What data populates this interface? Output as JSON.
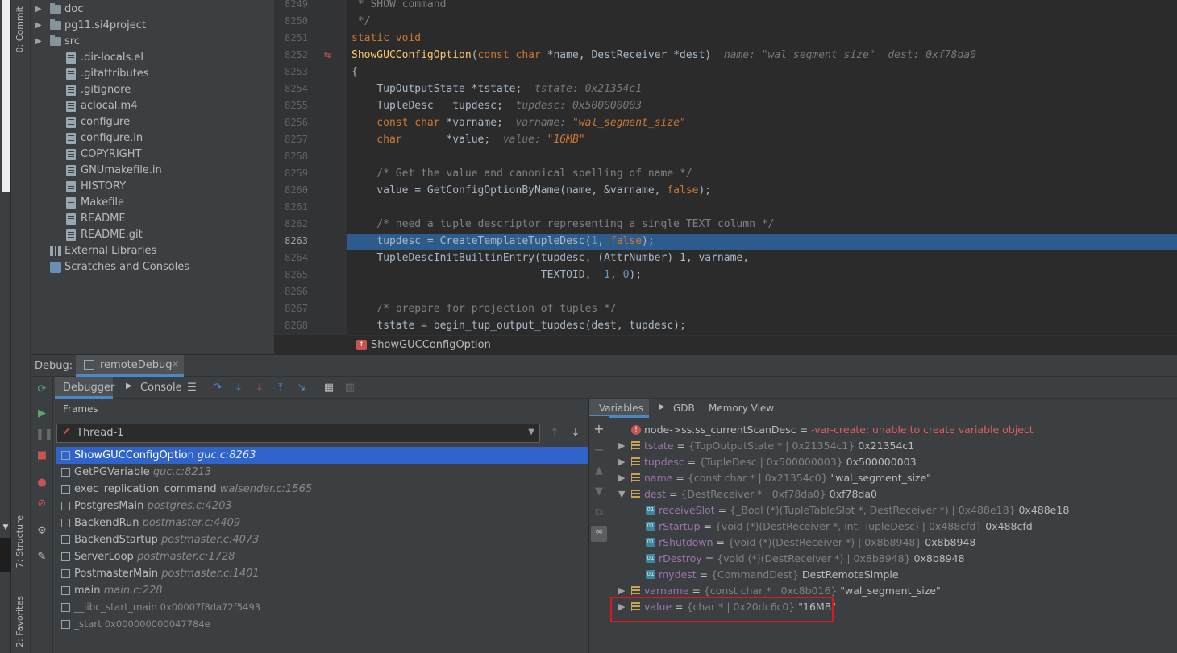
{
  "left_strip": {
    "commit": "0: Commit",
    "structure": "7: Structure",
    "favorites": "2: Favorites"
  },
  "project": {
    "items": [
      {
        "label": "doc",
        "kind": "folder",
        "expandable": true
      },
      {
        "label": "pg11.si4project",
        "kind": "folder",
        "expandable": true
      },
      {
        "label": "src",
        "kind": "folder",
        "expandable": true
      },
      {
        "label": ".dir-locals.el",
        "kind": "file"
      },
      {
        "label": ".gitattributes",
        "kind": "file"
      },
      {
        "label": ".gitignore",
        "kind": "file"
      },
      {
        "label": "aclocal.m4",
        "kind": "file"
      },
      {
        "label": "configure",
        "kind": "file"
      },
      {
        "label": "configure.in",
        "kind": "file"
      },
      {
        "label": "COPYRIGHT",
        "kind": "file"
      },
      {
        "label": "GNUmakefile.in",
        "kind": "file"
      },
      {
        "label": "HISTORY",
        "kind": "file"
      },
      {
        "label": "Makefile",
        "kind": "file"
      },
      {
        "label": "README",
        "kind": "file"
      },
      {
        "label": "README.git",
        "kind": "file"
      },
      {
        "label": "External Libraries",
        "kind": "lib"
      },
      {
        "label": "Scratches and Consoles",
        "kind": "scratch"
      }
    ]
  },
  "editor": {
    "line_numbers": [
      "8249",
      "8250",
      "8251",
      "8252",
      "8253",
      "8254",
      "8255",
      "8256",
      "8257",
      "8258",
      "8259",
      "8260",
      "8261",
      "8262",
      "8263",
      "8264",
      "8265",
      "8266",
      "8267",
      "8268"
    ],
    "current_line": "8263",
    "lines": {
      "l0": " * SHOW command",
      "l1": " */",
      "l2a": "static void",
      "l3_fn": "ShowGUCConfigOption",
      "l3_a": "(",
      "l3_k1": "const char",
      "l3_b": " *name, DestReceiver *dest)",
      "l3_hint1": "name: ",
      "l3_hint1v": "\"wal_segment_size\"",
      "l3_hint2": "dest: 0xf78da0",
      "l4": "{",
      "l5": "    TupOutputState *tstate;",
      "l5_hint": "tstate: 0x21354c1",
      "l6": "    TupleDesc   tupdesc;",
      "l6_hint": "tupdesc: 0x500000003",
      "l7_k": "    const char",
      "l7": " *varname;",
      "l7_hint": "varname: ",
      "l7_hintv": "\"wal_segment_size\"",
      "l8_k": "    char",
      "l8": "       *value;",
      "l8_hint": "value: ",
      "l8_hintv": "\"16MB\"",
      "l10": "    /* Get the value and canonical spelling of name */",
      "l11a": "    value = GetConfigOptionByName(name, &varname, ",
      "l11k": "false",
      "l11b": ");",
      "l13": "    /* need a tuple descriptor representing a single TEXT column */",
      "l14a": "    tupdesc = CreateTemplateTupleDesc(",
      "l14n": "1",
      "l14b": ", ",
      "l14k": "false",
      "l14c": ");",
      "l15": "    TupleDescInitBuiltinEntry(tupdesc, (AttrNumber) 1, varname,",
      "l16a": "                              TEXTOID, ",
      "l16n": "-1",
      "l16b": ", ",
      "l16n2": "0",
      "l16c": ");",
      "l18": "    /* prepare for projection of tuples */",
      "l19": "    tstate = begin_tup_output_tupdesc(dest, tupdesc);"
    },
    "breadcrumb": "ShowGUCConfigOption"
  },
  "debug": {
    "label": "Debug:",
    "session": "remoteDebug",
    "tabs": {
      "debugger": "Debugger",
      "console": "Console"
    },
    "frames_title": "Frames",
    "thread": "Thread-1",
    "frames": [
      {
        "fn": "ShowGUCConfigOption",
        "loc": "guc.c:8263"
      },
      {
        "fn": "GetPGVariable",
        "loc": "guc.c:8213"
      },
      {
        "fn": "exec_replication_command",
        "loc": "walsender.c:1565"
      },
      {
        "fn": "PostgresMain",
        "loc": "postgres.c:4203"
      },
      {
        "fn": "BackendRun",
        "loc": "postmaster.c:4409"
      },
      {
        "fn": "BackendStartup",
        "loc": "postmaster.c:4073"
      },
      {
        "fn": "ServerLoop",
        "loc": "postmaster.c:1728"
      },
      {
        "fn": "PostmasterMain",
        "loc": "postmaster.c:1401"
      },
      {
        "fn": "main",
        "loc": "main.c:228"
      },
      {
        "fn": "__libc_start_main",
        "loc": "0x00007f8da72f5493"
      },
      {
        "fn": "_start",
        "loc": "0x000000000047784e"
      }
    ],
    "var_tabs": {
      "variables": "Variables",
      "gdb": "GDB",
      "memory": "Memory View"
    },
    "variables": [
      {
        "name": "node->ss.ss_currentScanDesc",
        "eq": " = ",
        "type": "",
        "value": "-var-create: unable to create variable object",
        "kind": "err"
      },
      {
        "name": "tstate",
        "eq": " = ",
        "type": "{TupOutputState * | 0x21354c1}",
        "value": " 0x21354c1",
        "kind": "field"
      },
      {
        "name": "tupdesc",
        "eq": " = ",
        "type": "{TupleDesc | 0x500000003}",
        "value": " 0x500000003",
        "kind": "field"
      },
      {
        "name": "name",
        "eq": " = ",
        "type": "{const char * | 0x21354c0}",
        "value": " \"wal_segment_size\"",
        "kind": "field"
      },
      {
        "name": "dest",
        "eq": " = ",
        "type": "{DestReceiver * | 0xf78da0}",
        "value": " 0xf78da0",
        "kind": "field"
      },
      {
        "name": "receiveSlot",
        "eq": " = ",
        "type": "{_Bool (*)(TupleTableSlot *, DestReceiver *) | 0x488e18}",
        "value": " 0x488e18",
        "kind": "o1"
      },
      {
        "name": "rStartup",
        "eq": " = ",
        "type": "{void (*)(DestReceiver *, int, TupleDesc) | 0x488cfd}",
        "value": " 0x488cfd",
        "kind": "o1"
      },
      {
        "name": "rShutdown",
        "eq": " = ",
        "type": "{void (*)(DestReceiver *) | 0x8b8948}",
        "value": " 0x8b8948",
        "kind": "o1"
      },
      {
        "name": "rDestroy",
        "eq": " = ",
        "type": "{void (*)(DestReceiver *) | 0x8b8948}",
        "value": " 0x8b8948",
        "kind": "o1"
      },
      {
        "name": "mydest",
        "eq": " = ",
        "type": "{CommandDest}",
        "value": " DestRemoteSimple",
        "kind": "o1"
      },
      {
        "name": "varname",
        "eq": " = ",
        "type": "{const char * | 0xc8b016}",
        "value": " \"wal_segment_size\"",
        "kind": "field"
      },
      {
        "name": "value",
        "eq": " = ",
        "type": "{char * | 0x20dc6c0}",
        "value": " \"16MB\"",
        "kind": "field"
      }
    ]
  }
}
